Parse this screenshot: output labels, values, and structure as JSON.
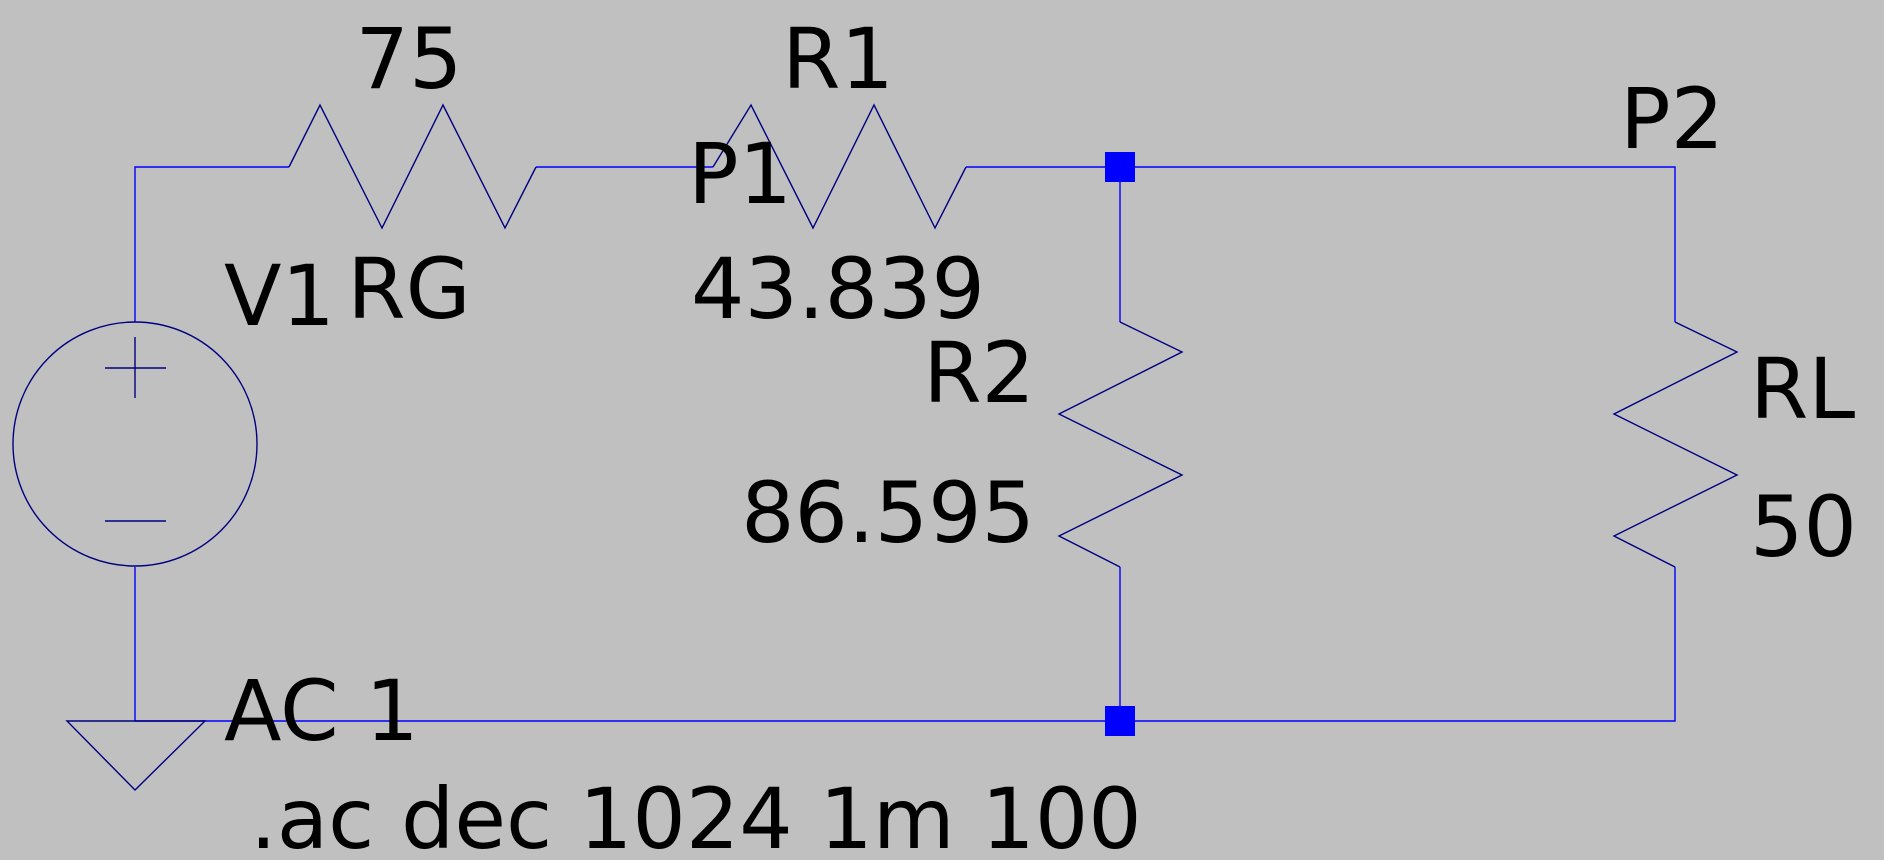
{
  "colors": {
    "background": "#c0c0c0",
    "wire": "#0000ff",
    "component": "#000080",
    "junction": "#0000ff",
    "text": "#000000"
  },
  "components": {
    "source": {
      "name": "V1",
      "value": "AC 1"
    },
    "rg": {
      "name": "RG",
      "value": "75"
    },
    "r1": {
      "name": "R1",
      "value": "43.839"
    },
    "r2": {
      "name": "R2",
      "value": "86.595"
    },
    "rl": {
      "name": "RL",
      "value": "50"
    }
  },
  "net_labels": {
    "p1": "P1",
    "p2": "P2"
  },
  "directive": ".ac dec 1024 1m 100"
}
